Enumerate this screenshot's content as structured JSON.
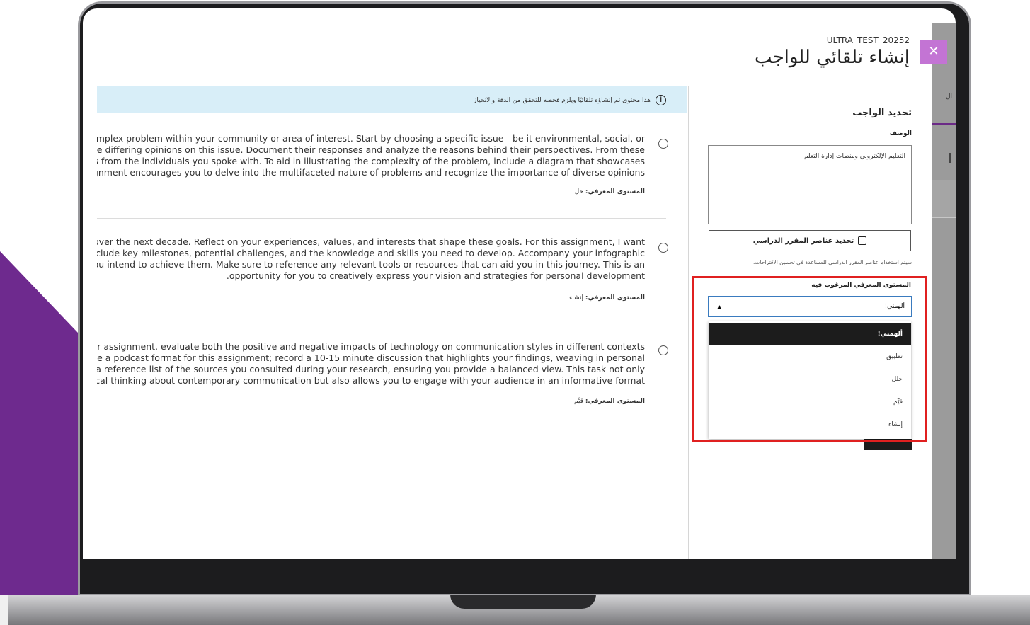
{
  "header": {
    "course_id": "ULTRA_TEST_20252",
    "title": "إنشاء تلقائي للواجب",
    "close_glyph": "✕"
  },
  "banner": {
    "text": "هذا محتوى تم إنشاؤه تلقائيًا ويلزم فحصه للتحقق من الدقة والانحياز"
  },
  "assignments": [
    {
      "lines": [
        "complex problem within your community or area of interest. Start by choosing a specific issue—be it environmental, social, or",
        "ve differing opinions on this issue. Document their responses and analyze the reasons behind their perspectives. From these",
        "es from the individuals you spoke with. To aid in illustrating the complexity of the problem, include a diagram that showcases",
        "ignment encourages you to delve into the multifaceted nature of problems and recognize the importance of diverse opinions"
      ],
      "level_label": "المستوى المعرفي:",
      "level_value": "حل"
    },
    {
      "lines": [
        "e over the next decade. Reflect on your experiences, values, and interests that shape these goals. For this assignment, I want",
        "include key milestones, potential challenges, and the knowledge and skills you need to develop. Accompany your infographic",
        "you intend to achieve them. Make sure to reference any relevant tools or resources that can aid you in this journey. This is an",
        ".opportunity for you to creatively express your vision and strategies for personal development"
      ],
      "level_label": "المستوى المعرفي:",
      "level_value": "إنشاء"
    },
    {
      "lines": [
        "our assignment, evaluate both the positive and negative impacts of technology on communication styles in different contexts",
        "lize a podcast format for this assignment; record a 10-15 minute discussion that highlights your findings, weaving in personal",
        "e a reference list of the sources you consulted during your research, ensuring you provide a balanced view. This task not only",
        "tical thinking about contemporary communication but also allows you to engage with your audience in an informative format"
      ],
      "level_label": "المستوى المعرفي:",
      "level_value": "قيِّم"
    }
  ],
  "side": {
    "heading": "تحديد الواجب",
    "description_label": "الوصف",
    "description_value": "التعليم الإلكتروني ومنصات إدارة التعلم",
    "select_items_button": "تحديد عناصر المقرر الدراسي",
    "hint": "سيتم استخدام عناصر المقرر الدراسي للمساعدة في تحسين الاقتراحات.",
    "level_select_label": "المستوى المعرفي المرغوب فيه",
    "level_selected": "ألهمني!",
    "level_options": [
      "ألهمني!",
      "تطبيق",
      "حلل",
      "قيِّم",
      "إنشاء"
    ],
    "strip_tab": "ال"
  },
  "colors": {
    "accent_purple": "#6b2a87",
    "close_button": "#c374d4",
    "banner_bg": "#d8eef8",
    "highlight_red": "#e02020"
  }
}
